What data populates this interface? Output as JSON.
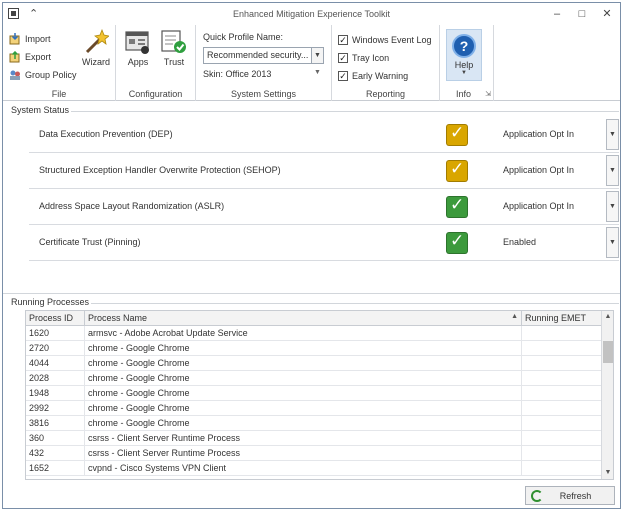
{
  "window": {
    "title": "Enhanced Mitigation Experience Toolkit"
  },
  "ribbon": {
    "file": {
      "group_label": "File",
      "import_label": "Import",
      "export_label": "Export",
      "group_policy_label": "Group Policy",
      "wizard_label": "Wizard"
    },
    "configuration": {
      "group_label": "Configuration",
      "apps_label": "Apps",
      "trust_label": "Trust"
    },
    "system_settings": {
      "group_label": "System Settings",
      "quick_profile_label": "Quick Profile Name:",
      "quick_profile_value": "Recommended security...",
      "skin_value": "Skin: Office 2013"
    },
    "reporting": {
      "group_label": "Reporting",
      "windows_event_log_label": "Windows Event Log",
      "tray_icon_label": "Tray Icon",
      "early_warning_label": "Early Warning",
      "windows_event_log_checked": true,
      "tray_icon_checked": true,
      "early_warning_checked": true
    },
    "info": {
      "group_label": "Info",
      "help_label": "Help"
    }
  },
  "system_status": {
    "title": "System Status",
    "items": [
      {
        "name": "Data Execution Prevention (DEP)",
        "value": "Application Opt In",
        "state": "warning"
      },
      {
        "name": "Structured Exception Handler Overwrite Protection (SEHOP)",
        "value": "Application Opt In",
        "state": "warning"
      },
      {
        "name": "Address Space Layout Randomization (ASLR)",
        "value": "Application Opt In",
        "state": "ok"
      },
      {
        "name": "Certificate Trust (Pinning)",
        "value": "Enabled",
        "state": "ok"
      }
    ]
  },
  "processes": {
    "title": "Running Processes",
    "columns": {
      "pid": "Process ID",
      "name": "Process Name",
      "emet": "Running EMET"
    },
    "rows": [
      {
        "pid": "1620",
        "name": "armsvc - Adobe Acrobat Update Service",
        "emet": ""
      },
      {
        "pid": "2720",
        "name": "chrome - Google Chrome",
        "emet": ""
      },
      {
        "pid": "4044",
        "name": "chrome - Google Chrome",
        "emet": ""
      },
      {
        "pid": "2028",
        "name": "chrome - Google Chrome",
        "emet": ""
      },
      {
        "pid": "1948",
        "name": "chrome - Google Chrome",
        "emet": ""
      },
      {
        "pid": "2992",
        "name": "chrome - Google Chrome",
        "emet": ""
      },
      {
        "pid": "3816",
        "name": "chrome - Google Chrome",
        "emet": ""
      },
      {
        "pid": "360",
        "name": "csrss - Client Server Runtime Process",
        "emet": ""
      },
      {
        "pid": "432",
        "name": "csrss - Client Server Runtime Process",
        "emet": ""
      },
      {
        "pid": "1652",
        "name": "cvpnd - Cisco Systems VPN Client",
        "emet": ""
      }
    ],
    "refresh_label": "Refresh"
  },
  "colors": {
    "warning_icon": "#d9a600",
    "ok_icon": "#3c9a3c",
    "help_icon": "#1f5fb0"
  }
}
